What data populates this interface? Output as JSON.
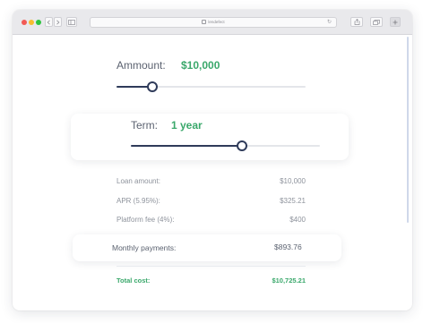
{
  "browser": {
    "address": "lendefect"
  },
  "amount": {
    "label": "Ammount:",
    "value": "$10,000",
    "slider_fraction": 0.19
  },
  "term": {
    "label": "Term:",
    "value": "1 year",
    "slider_fraction": 0.59
  },
  "breakdown": [
    {
      "label": "Loan amount:",
      "value": "$10,000"
    },
    {
      "label": "APR (5.95%):",
      "value": "$325.21"
    },
    {
      "label": "Platform fee (4%):",
      "value": "$400"
    }
  ],
  "monthly": {
    "label": "Monthly payments:",
    "value": "$893.76"
  },
  "total": {
    "label": "Total cost:",
    "value": "$10,725.21"
  },
  "colors": {
    "accent_green": "#3aa86b",
    "slider_navy": "#2f3b5a"
  }
}
